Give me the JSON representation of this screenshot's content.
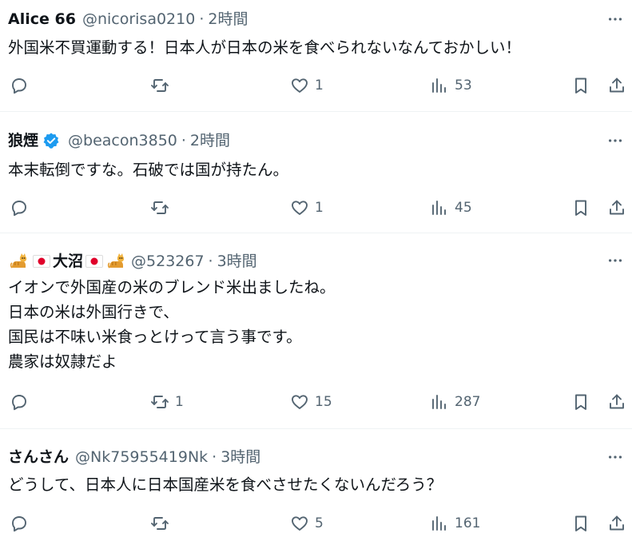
{
  "tweets": [
    {
      "name": "Alice 66",
      "handle": "@nicorisa0210",
      "time": "2時間",
      "text": "外国米不買運動する！日本人が日本の米を食べられないなんておかしい！",
      "replies": "",
      "retweets": "",
      "likes": "1",
      "views": "53"
    },
    {
      "name": "狼煙",
      "handle": "@beacon3850",
      "time": "2時間",
      "text": "本末転倒ですな。石破では国が持たん。",
      "replies": "",
      "retweets": "",
      "likes": "1",
      "views": "45"
    },
    {
      "name": "大沼",
      "handle": "@523267",
      "time": "3時間",
      "text": "イオンで外国産の米のブレンド米出ましたね。\n日本の米は外国行きで、\n国民は不味い米食っとけって言う事です。\n農家は奴隷だよ",
      "replies": "",
      "retweets": "1",
      "likes": "15",
      "views": "287"
    },
    {
      "name": "さんさん",
      "handle": "@Nk75955419Nk",
      "time": "3時間",
      "text": "どうして、日本人に日本国産米を食べさせたくないんだろう？",
      "replies": "",
      "retweets": "",
      "likes": "5",
      "views": "161"
    }
  ],
  "separator": "·",
  "colors": {
    "text": "#0f1419",
    "secondary": "#536471",
    "verified": "#1d9bf0",
    "divider": "#eff3f4"
  }
}
